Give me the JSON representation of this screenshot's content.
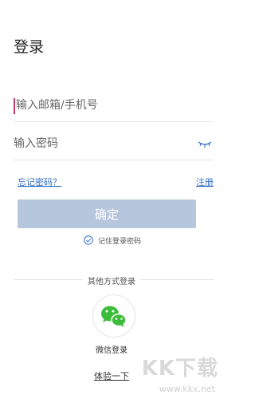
{
  "page": {
    "title": "登录"
  },
  "form": {
    "email_placeholder": "输入邮箱/手机号",
    "password_placeholder": "输入密码"
  },
  "links": {
    "forgot_password": "忘记密码？",
    "register": "注册"
  },
  "buttons": {
    "confirm": "确定"
  },
  "remember": {
    "label": "记住登录密码"
  },
  "other_login": {
    "label": "其他方式登录",
    "wechat_label": "微信登录",
    "wechat_icon": "wechat-icon"
  },
  "trial": {
    "label": "体验一下"
  },
  "watermark": {
    "logo": "KK下载",
    "url": "www.kkx.net"
  },
  "colors": {
    "link": "#2f6cc5",
    "confirm_button": "#b6c7dd",
    "wechat_green": "#3dbb3a",
    "caret": "#c0396b"
  }
}
